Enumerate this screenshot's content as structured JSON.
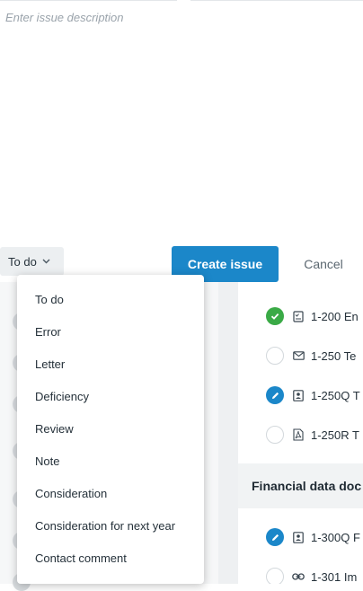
{
  "form": {
    "description_placeholder": "Enter issue description",
    "status_value": "To do",
    "create_label": "Create issue",
    "cancel_label": "Cancel",
    "accent": "#1b87c9"
  },
  "status_menu": {
    "items": [
      "To do",
      "Error",
      "Letter",
      "Deficiency",
      "Review",
      "Note",
      "Consideration",
      "Consideration for next year",
      "Contact comment"
    ]
  },
  "documents": {
    "rows": [
      {
        "status": "done",
        "file_icon": "checklist-icon",
        "label": "1-200 En"
      },
      {
        "status": "empty",
        "file_icon": "envelope-icon",
        "label": "1-250 Te"
      },
      {
        "status": "edit",
        "file_icon": "contact-card-icon",
        "label": "1-250Q T"
      },
      {
        "status": "empty",
        "file_icon": "pdf-icon",
        "label": "1-250R T"
      }
    ],
    "section_title": "Financial data doc",
    "section_rows": [
      {
        "status": "edit",
        "file_icon": "contact-card-icon",
        "label": "1-300Q F"
      },
      {
        "status": "empty",
        "file_icon": "link-icon",
        "label": "1-301 Im"
      }
    ],
    "colors": {
      "done": "#3aaa46",
      "edit": "#1b87c9"
    }
  }
}
